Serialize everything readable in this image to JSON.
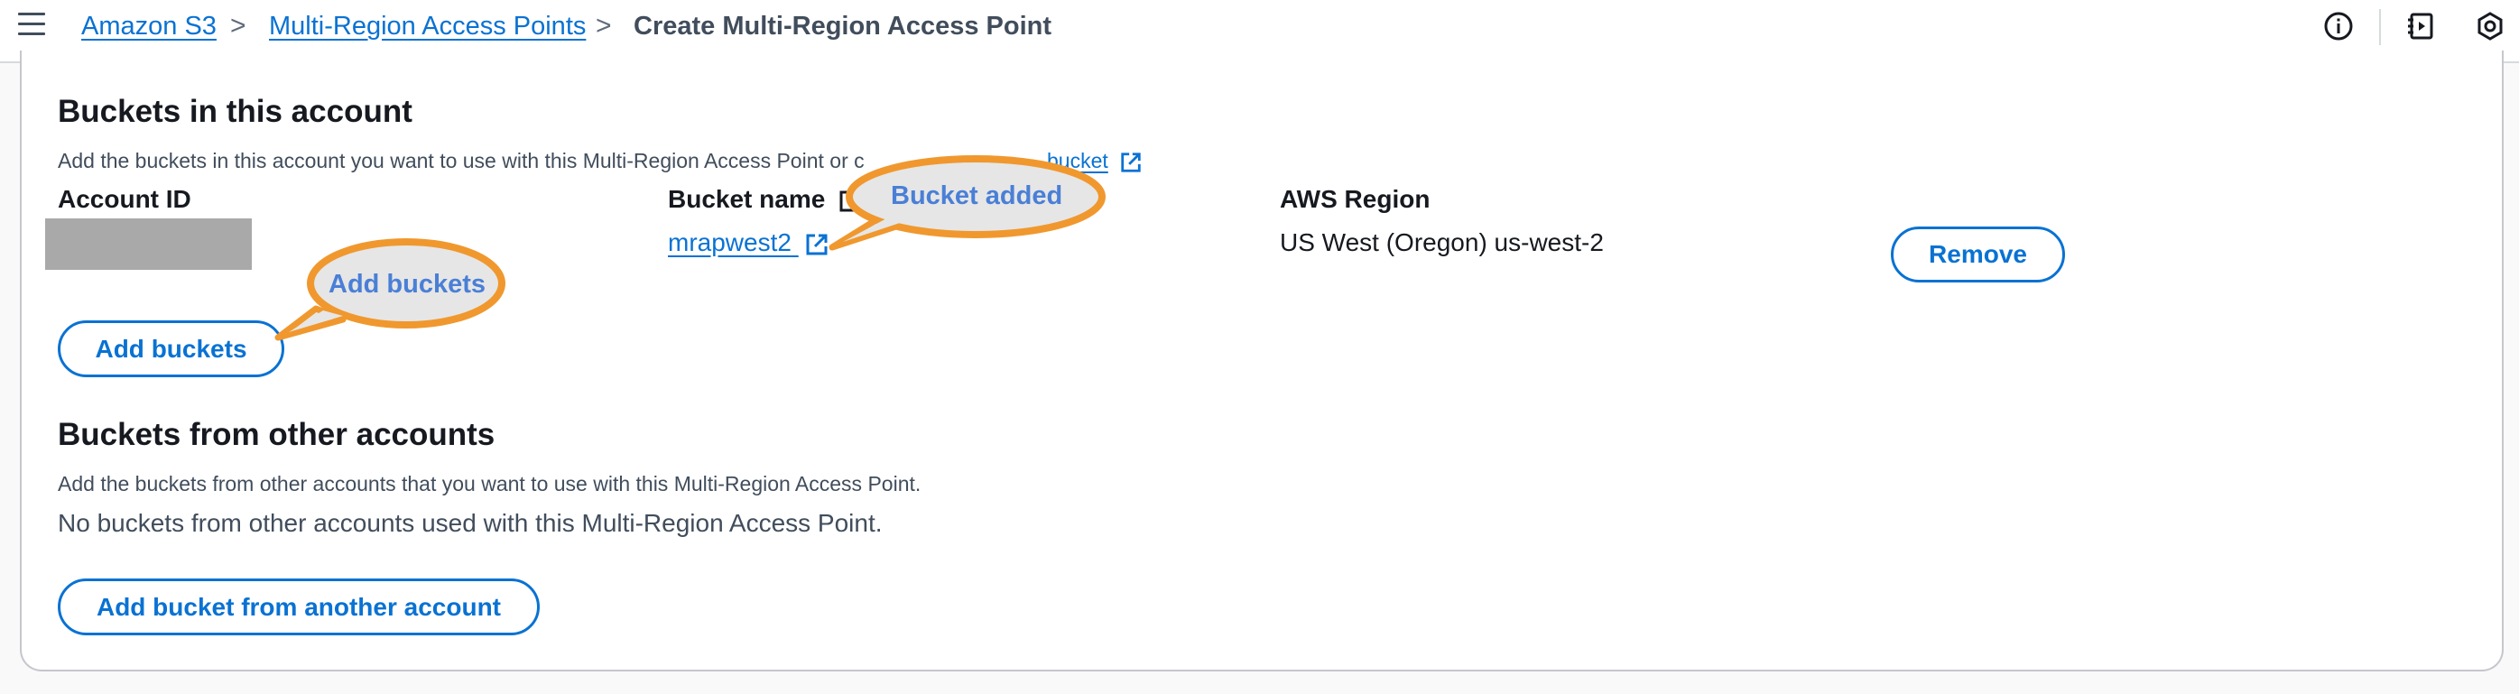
{
  "breadcrumb": {
    "items": [
      {
        "label": "Amazon S3"
      },
      {
        "label": "Multi-Region Access Points"
      },
      {
        "label": "Create Multi-Region Access Point"
      }
    ],
    "separator": ">"
  },
  "header_icons": [
    "info-icon",
    "notes-icon",
    "settings-hex-icon"
  ],
  "buckets_in_account": {
    "title": "Buckets in this account",
    "description_prefix": "Add the buckets in this account you want to use with this Multi-Region Access Point or c",
    "description_link": "bucket",
    "columns": {
      "account_id": "Account ID",
      "bucket_name": "Bucket name",
      "aws_region": "AWS Region"
    },
    "rows": [
      {
        "bucket_name": "mrapwest2",
        "aws_region": "US West (Oregon) us-west-2",
        "remove_label": "Remove"
      }
    ],
    "add_button": "Add buckets"
  },
  "buckets_other_accounts": {
    "title": "Buckets from other accounts",
    "description": "Add the buckets from other accounts that you want to use with this Multi-Region Access Point.",
    "empty_text": "No buckets from other accounts used with this Multi-Region Access Point.",
    "add_button": "Add bucket from another account"
  },
  "annotations": {
    "bucket_added": "Bucket added",
    "add_buckets": "Add buckets"
  },
  "colors": {
    "link": "#0972d3",
    "callout_border": "#f0982e",
    "callout_fill": "#e6e6e6",
    "callout_text": "#4a7fd6",
    "redacted": "#a9a9a9"
  }
}
